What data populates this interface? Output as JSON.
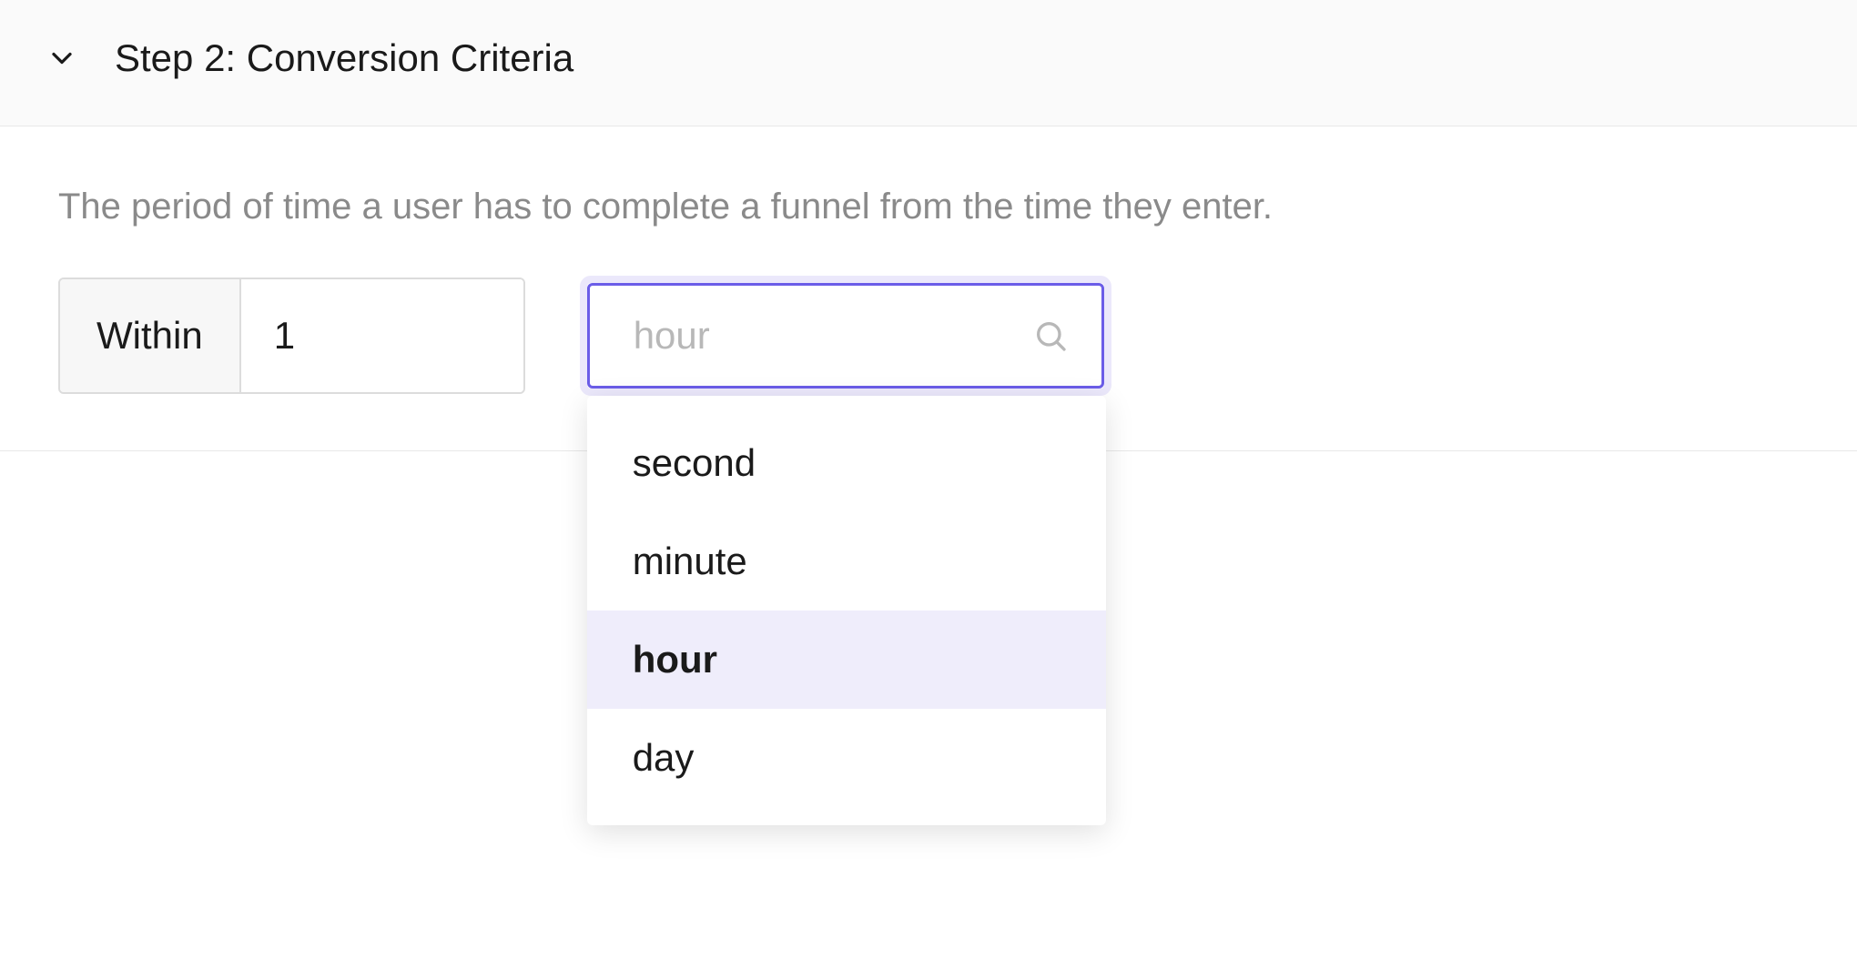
{
  "header": {
    "title": "Step 2: Conversion Criteria"
  },
  "body": {
    "description": "The period of time a user has to complete a funnel from the time they enter.",
    "prefix_label": "Within",
    "quantity_value": "1",
    "unit_search_placeholder": "hour",
    "unit_options": [
      {
        "label": "second",
        "selected": false
      },
      {
        "label": "minute",
        "selected": false
      },
      {
        "label": "hour",
        "selected": true
      },
      {
        "label": "day",
        "selected": false
      }
    ]
  },
  "icons": {
    "chevron_down": "chevron-down",
    "search": "search"
  }
}
